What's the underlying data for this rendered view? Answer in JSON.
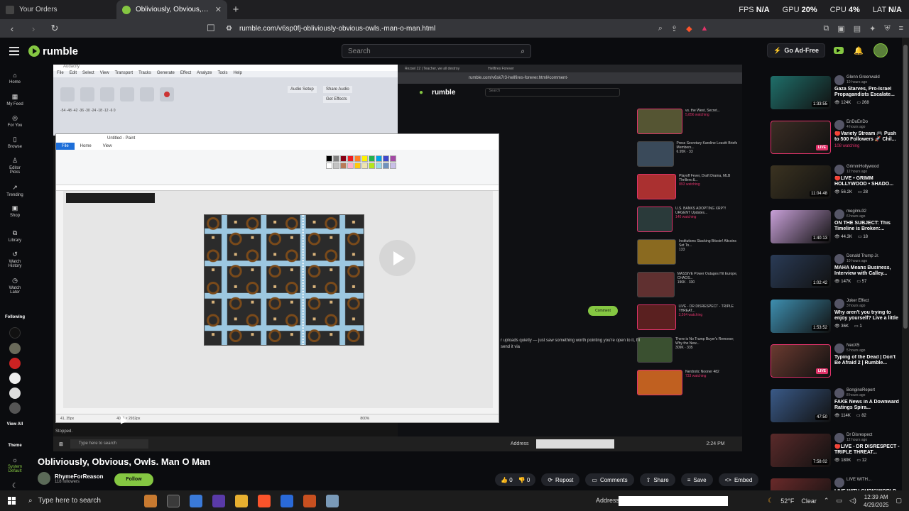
{
  "browser": {
    "tabs": [
      {
        "title": "Your Orders",
        "active": false,
        "favicon_color": "#444"
      },
      {
        "title": "Obliviously, Obvious, Owls. Ma",
        "active": true,
        "favicon_color": "#85c742"
      }
    ],
    "new_tab": "+",
    "stats": {
      "fps_label": "FPS",
      "fps": "N/A",
      "gpu_label": "GPU",
      "gpu": "20%",
      "cpu_label": "CPU",
      "cpu": "4%",
      "lat_label": "LAT",
      "lat": "N/A"
    },
    "url": "rumble.com/v6sp0fj-obliviously-obvious-owls.-man-o-man.html"
  },
  "header": {
    "logo_text": "rumble",
    "search_placeholder": "Search",
    "ad_free_label": "Go Ad-Free"
  },
  "sidebar": {
    "nav": [
      {
        "label": "Home",
        "icon": "home-icon"
      },
      {
        "label": "My Feed",
        "icon": "feed-icon"
      },
      {
        "label": "For You",
        "icon": "for-you-icon"
      },
      {
        "label": "Browse",
        "icon": "browse-icon"
      },
      {
        "label": "Editor Picks",
        "icon": "editor-picks-icon"
      },
      {
        "label": "Trending",
        "icon": "trending-icon"
      },
      {
        "label": "Shop",
        "icon": "shop-icon"
      },
      {
        "label": "Library",
        "icon": "library-icon"
      },
      {
        "label": "Watch History",
        "icon": "history-icon"
      },
      {
        "label": "Watch Later",
        "icon": "watch-later-icon"
      }
    ],
    "following_heading": "Following",
    "view_all": "View All",
    "theme_heading": "Theme",
    "theme_option": "System Default"
  },
  "video_content": {
    "audacity_title": "Audacity",
    "audacity_menu": [
      "File",
      "Edit",
      "Select",
      "View",
      "Transport",
      "Tracks",
      "Generate",
      "Effect",
      "Analyze",
      "Tools",
      "Help"
    ],
    "audacity_share": "Share Audio",
    "audacity_effects": "Get Effects",
    "audacity_setup": "Audio Setup",
    "audacity_meter": "-54 -48 -42 -36 -30 -24 -18 -12 -6 0",
    "audacity_status": "Stopped.",
    "paint_title": "Untitled - Paint",
    "paint_tabs": [
      "File",
      "Home",
      "View"
    ],
    "paint_status_pos": "41, 35px",
    "paint_status_size": "4096 × 2932px",
    "paint_zoom": "800%",
    "inner_tab1": "Rezsel 22 | Teacher, we all destroy",
    "inner_tab2": "Hellfires Forever",
    "inner_url": "rumble.com/v6sk7r3-hellfires-forever.html#comment-",
    "inner_search": "Search",
    "inner_comment_btn": "Comment",
    "inner_text": "r uploads quietly — just saw something worth pointing you're open to it, I'll send it via",
    "inner_list": [
      {
        "title": "vs. the West, Secret...",
        "watch": "5,856 watching"
      },
      {
        "title": "Press Secretary Karoline Leavitt Briefs Members...",
        "watch": "6.95K · 33"
      },
      {
        "title": "Playoff Fever, Draft Drama, MLB Thrillers &...",
        "watch": "893 watching"
      },
      {
        "title": "U.S. BANKS ADOPTING XRP?! URGENT Updates...",
        "watch": "140 watching"
      },
      {
        "title": "Institutions Stacking Bitcoin! Altcoins Set To...",
        "watch": "133"
      },
      {
        "title": "MASSIVE Power Outages Hit Europe, CHAOS...",
        "watch": "196K · 330"
      },
      {
        "title": "LIVE - DR DISRESPECT - TRIPLE THREAT...",
        "watch": "3,264 watching"
      },
      {
        "title": "There is No Trump Buyer's Remorse; Why the New...",
        "watch": "309K · 335"
      },
      {
        "title": "Nerdrotic Nooner 482",
        "watch": "733 watching"
      }
    ],
    "taskbar_search": "Type here to search",
    "taskbar_address": "Address",
    "taskbar_time": "2:24 PM"
  },
  "video": {
    "title": "Obliviously, Obvious, Owls. Man O Man",
    "channel": "RhymeForReason",
    "followers": "118 followers",
    "follow_label": "Follow",
    "likes": "0",
    "dislikes": "0",
    "repost_label": "Repost",
    "comments_label": "Comments",
    "share_label": "Share",
    "save_label": "Save",
    "embed_label": "Embed"
  },
  "recommendations": [
    {
      "channel": "Glenn Greenwald",
      "time": "10 hours ago",
      "title": "Gaza Starves, Pro-Israel Propagandists Escalate...",
      "views": "124K",
      "comments": "268",
      "duration": "1:33:55",
      "live": false,
      "thumb": "#1f6f6a"
    },
    {
      "channel": "EnDuEnDo",
      "time": "4 hours ago",
      "title": "🔴Variety Stream 🎮 Push to 500 Followers 🚀 Chil...",
      "watching": "108 watching",
      "live": true,
      "thumb": "#3a2d24"
    },
    {
      "channel": "GrimmHollywood",
      "time": "12 hours ago",
      "title": "🔴LIVE • GRIMM HOLLYWOOD • SHADO...",
      "views": "56.2K",
      "comments": "28",
      "duration": "11:04:48",
      "live": false,
      "thumb": "#3b3321"
    },
    {
      "channel": "megimu32",
      "time": "6 hours ago",
      "title": "ON THE SUBJECT: This Timeline is Broken:...",
      "views": "44.3K",
      "comments": "18",
      "duration": "1:40:13",
      "live": false,
      "thumb": "#c8a0d8"
    },
    {
      "channel": "Donald Trump Jr.",
      "time": "10 hours ago",
      "title": "MAHA Means Business, Interview with Calley...",
      "views": "147K",
      "comments": "57",
      "duration": "1:02:42",
      "live": false,
      "thumb": "#2a3b56"
    },
    {
      "channel": "Joker Effect",
      "time": "3 hours ago",
      "title": "Why aren't you trying to enjoy yourself? Live a little",
      "views": "36K",
      "comments": "1",
      "duration": "1:53:52",
      "live": false,
      "thumb": "#3e8fb0"
    },
    {
      "channel": "NeoX5",
      "time": "5 hours ago",
      "title": "Typing of the Dead | Don't Be Afraid 2 | Rumble...",
      "watching": "",
      "live": true,
      "thumb": "#6a3a30"
    },
    {
      "channel": "BonginoReport",
      "time": "8 hours ago",
      "title": "FAKE News in A Downward Ratings Spira...",
      "views": "114K",
      "comments": "82",
      "duration": "47:50",
      "live": false,
      "thumb": "#3a5a88"
    },
    {
      "channel": "Dr Disrespect",
      "time": "12 hours ago",
      "title": "🔴LIVE - DR DISRESPECT - TRIPLE THREAT...",
      "views": "180K",
      "comments": "12",
      "duration": "7:58:02",
      "live": false,
      "thumb": "#5a2a2a"
    },
    {
      "channel": "LIVE WITH...",
      "time": "",
      "title": "LIVE WITH CHRIS'WORLD",
      "views": "",
      "comments": "",
      "duration": "",
      "live": false,
      "thumb": "#6a2a2a"
    }
  ],
  "os_taskbar": {
    "search_placeholder": "Type here to search",
    "address_label": "Address",
    "weather": "52°F",
    "weather_desc": "Clear",
    "time": "12:39 AM",
    "date": "4/29/2025"
  },
  "colors": {
    "accent": "#85c742",
    "live": "#e0336a"
  }
}
